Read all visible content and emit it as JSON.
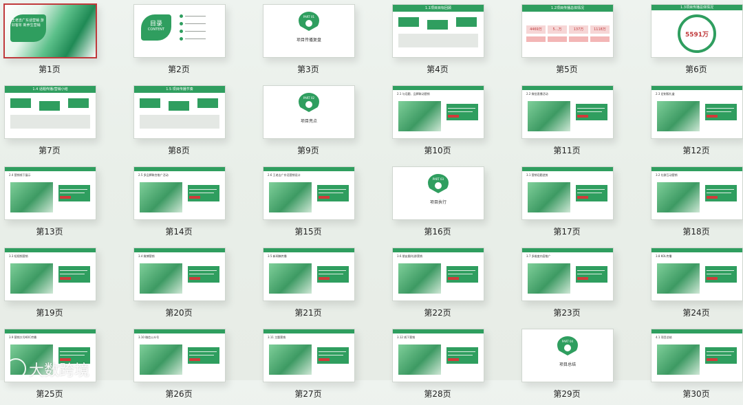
{
  "slides": [
    {
      "caption": "第1页",
      "selected": true,
      "kind": "cover",
      "title": "王老吉广东话营销 游好客年 新养生营销"
    },
    {
      "caption": "第2页",
      "kind": "toc",
      "title": "目录",
      "subtitle": "CONTENT"
    },
    {
      "caption": "第3页",
      "kind": "part",
      "part": "PART 01",
      "subtitle": "项目传播复盘"
    },
    {
      "caption": "第4页",
      "kind": "bar",
      "title": "1.1项目目标回顾"
    },
    {
      "caption": "第5页",
      "kind": "stats",
      "title": "1.2项目传播总体情况",
      "values": [
        "4469万",
        "5...万",
        "137万",
        "1118万"
      ]
    },
    {
      "caption": "第6页",
      "kind": "ring",
      "title": "1.3项目传播总体情况",
      "value": "5591万"
    },
    {
      "caption": "第7页",
      "kind": "bar",
      "title": "1.4 话题传播/营销小结"
    },
    {
      "caption": "第8页",
      "kind": "bar",
      "title": "1.5 项目传播节奏"
    },
    {
      "caption": "第9页",
      "kind": "part",
      "part": "PART 02",
      "subtitle": "项目亮点"
    },
    {
      "caption": "第10页",
      "kind": "text",
      "title": "2.1 与话题、品牌联动营销"
    },
    {
      "caption": "第11页",
      "kind": "text",
      "title": "2.2 微信直播活动"
    },
    {
      "caption": "第12页",
      "kind": "text",
      "title": "2.3 定制版礼盒"
    },
    {
      "caption": "第13页",
      "kind": "text",
      "title": "2.4 营销线下展示"
    },
    {
      "caption": "第14页",
      "kind": "text",
      "title": "2.5 多品牌联合推广活动"
    },
    {
      "caption": "第15页",
      "kind": "text",
      "title": "2.6 王老吉广东话营销设计"
    },
    {
      "caption": "第16页",
      "kind": "part",
      "part": "PART 03",
      "subtitle": "项目执行"
    },
    {
      "caption": "第17页",
      "kind": "text",
      "title": "3.1 营销话题造势"
    },
    {
      "caption": "第18页",
      "kind": "text",
      "title": "3.2 社群互动营销"
    },
    {
      "caption": "第19页",
      "kind": "text",
      "title": "3.3 短视频营销"
    },
    {
      "caption": "第20页",
      "kind": "text",
      "title": "3.4 微博营销"
    },
    {
      "caption": "第21页",
      "kind": "text",
      "title": "3.5 新闻稿传播"
    },
    {
      "caption": "第22页",
      "kind": "text",
      "title": "3.6 朋友圈/社群营销"
    },
    {
      "caption": "第23页",
      "kind": "text",
      "title": "3.7 多维度内容推广"
    },
    {
      "caption": "第24页",
      "kind": "text",
      "title": "3.8 KOL传播"
    },
    {
      "caption": "第25页",
      "kind": "text",
      "title": "3.9 营销大号KOC传播"
    },
    {
      "caption": "第26页",
      "kind": "text",
      "title": "3.10 微信公众号"
    },
    {
      "caption": "第27页",
      "kind": "text",
      "title": "3.11 主题营销"
    },
    {
      "caption": "第28页",
      "kind": "text",
      "title": "3.12 线下营销"
    },
    {
      "caption": "第29页",
      "kind": "part",
      "part": "PART 04",
      "subtitle": "项目总结"
    },
    {
      "caption": "第30页",
      "kind": "text",
      "title": "4.1 项目总结"
    }
  ],
  "watermark": {
    "text": "大数跨境",
    "icon": "watermark-logo-icon"
  }
}
